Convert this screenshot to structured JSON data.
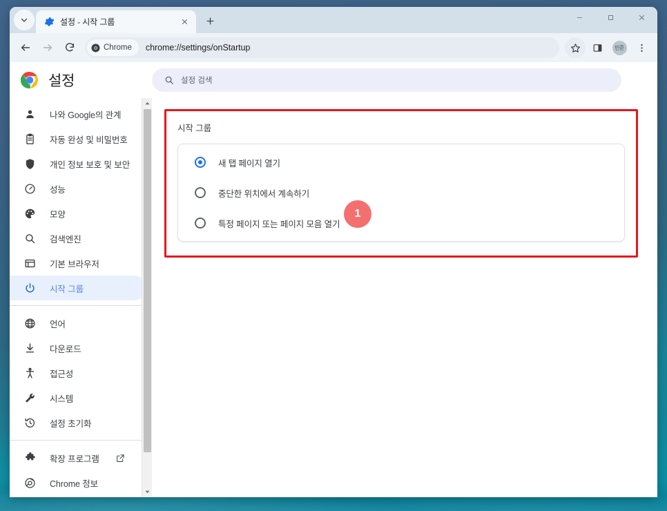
{
  "window": {
    "controls": {
      "minimize": "minimize-icon",
      "maximize": "maximize-icon",
      "close": "close-icon"
    }
  },
  "tabstrip": {
    "tab_search_icon": "chevron-down-icon",
    "tabs": [
      {
        "title": "설정 - 시작 그룹",
        "favicon": "settings-gear-icon",
        "active": true
      }
    ],
    "new_tab_label": "+"
  },
  "toolbar": {
    "back_icon": "arrow-back-icon",
    "forward_icon": "arrow-forward-icon",
    "reload_icon": "reload-icon",
    "chip_label": "Chrome",
    "url": "chrome://settings/onStartup",
    "bookmark_icon": "star-icon",
    "side_panel_icon": "side-panel-icon",
    "profile_initials": "민준",
    "menu_icon": "kebab-menu-icon"
  },
  "settings": {
    "brand_title": "설정",
    "search": {
      "placeholder": "설정 검색",
      "value": "",
      "icon": "search-icon"
    }
  },
  "sidebar": {
    "groups": [
      {
        "items": [
          {
            "label": "나와 Google의 관계",
            "icon": "person-icon",
            "active": false
          },
          {
            "label": "자동 완성 및 비밀번호",
            "icon": "clipboard-icon",
            "active": false
          },
          {
            "label": "개인 정보 보호 및 보안",
            "icon": "shield-icon",
            "active": false
          },
          {
            "label": "성능",
            "icon": "speedometer-icon",
            "active": false
          },
          {
            "label": "모양",
            "icon": "palette-icon",
            "active": false
          },
          {
            "label": "검색엔진",
            "icon": "search-icon",
            "active": false
          },
          {
            "label": "기본 브라우저",
            "icon": "browser-window-icon",
            "active": false
          },
          {
            "label": "시작 그룹",
            "icon": "power-icon",
            "active": true
          }
        ]
      },
      {
        "items": [
          {
            "label": "언어",
            "icon": "globe-icon",
            "active": false
          },
          {
            "label": "다운로드",
            "icon": "download-icon",
            "active": false
          },
          {
            "label": "접근성",
            "icon": "accessibility-icon",
            "active": false
          },
          {
            "label": "시스템",
            "icon": "wrench-icon",
            "active": false
          },
          {
            "label": "설정 초기화",
            "icon": "history-restore-icon",
            "active": false
          }
        ]
      },
      {
        "items": [
          {
            "label": "확장 프로그램",
            "icon": "puzzle-icon",
            "active": false,
            "external": true
          },
          {
            "label": "Chrome 정보",
            "icon": "chrome-icon",
            "active": false
          }
        ]
      }
    ],
    "scrollbar": {
      "up_arrow_icon": "triangle-up-icon",
      "down_arrow_icon": "triangle-down-icon"
    }
  },
  "main": {
    "section_title": "시작 그룹",
    "options": [
      {
        "label": "새 탭 페이지 열기",
        "checked": true
      },
      {
        "label": "중단한 위치에서 계속하기",
        "checked": false
      },
      {
        "label": "특정 페이지 또는 페이지 모음 열기",
        "checked": false
      }
    ],
    "annotation": {
      "badge_number": "1",
      "badge_color": "#f4706f",
      "box_color": "#e8161b"
    }
  }
}
